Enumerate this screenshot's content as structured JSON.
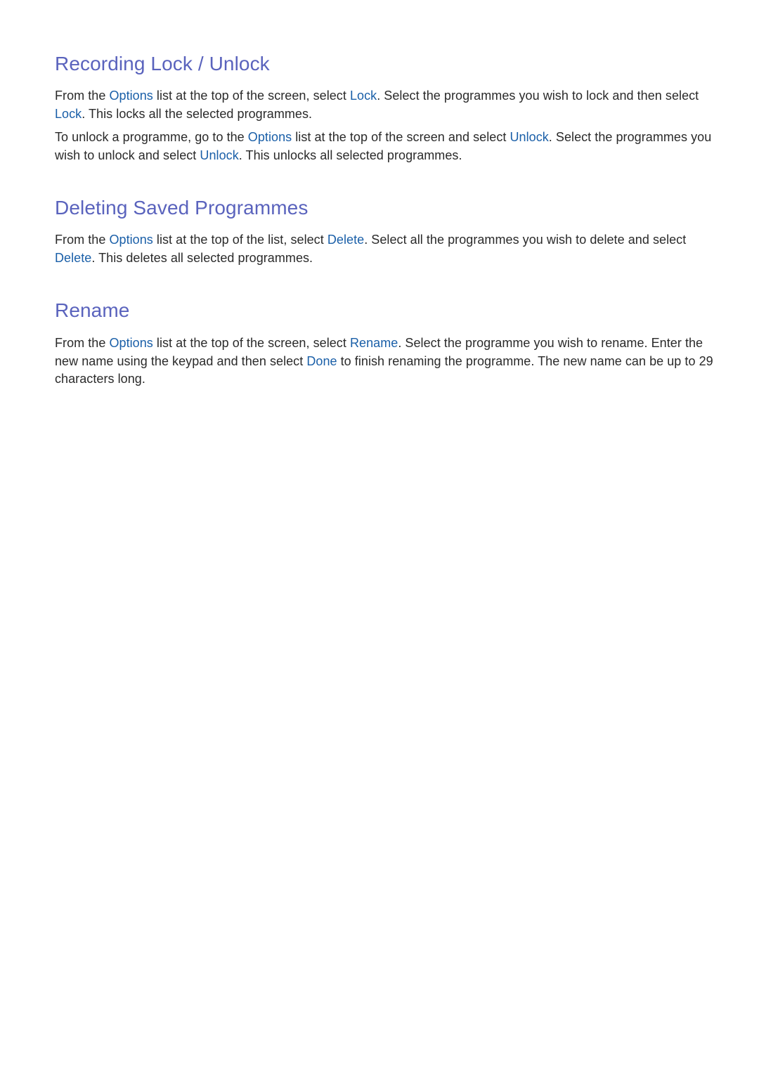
{
  "sections": [
    {
      "title": "Recording Lock / Unlock",
      "paragraphs": [
        {
          "segments": [
            {
              "text": "From the ",
              "kw": false
            },
            {
              "text": "Options",
              "kw": true
            },
            {
              "text": " list at the top of the screen, select ",
              "kw": false
            },
            {
              "text": "Lock",
              "kw": true
            },
            {
              "text": ". Select the programmes you wish to lock and then select ",
              "kw": false
            },
            {
              "text": "Lock",
              "kw": true
            },
            {
              "text": ". This locks all the selected programmes.",
              "kw": false
            }
          ]
        },
        {
          "segments": [
            {
              "text": "To unlock a programme, go to the ",
              "kw": false
            },
            {
              "text": "Options",
              "kw": true
            },
            {
              "text": " list at the top of the screen and select ",
              "kw": false
            },
            {
              "text": "Unlock",
              "kw": true
            },
            {
              "text": ". Select the programmes you wish to unlock and select ",
              "kw": false
            },
            {
              "text": "Unlock",
              "kw": true
            },
            {
              "text": ". This unlocks all selected programmes.",
              "kw": false
            }
          ]
        }
      ]
    },
    {
      "title": "Deleting Saved Programmes",
      "paragraphs": [
        {
          "segments": [
            {
              "text": "From the ",
              "kw": false
            },
            {
              "text": "Options",
              "kw": true
            },
            {
              "text": " list at the top of the list, select ",
              "kw": false
            },
            {
              "text": "Delete",
              "kw": true
            },
            {
              "text": ". Select all the programmes you wish to delete and select ",
              "kw": false
            },
            {
              "text": "Delete",
              "kw": true
            },
            {
              "text": ". This deletes all selected programmes.",
              "kw": false
            }
          ]
        }
      ]
    },
    {
      "title": "Rename",
      "paragraphs": [
        {
          "segments": [
            {
              "text": "From the ",
              "kw": false
            },
            {
              "text": "Options",
              "kw": true
            },
            {
              "text": " list at the top of the screen, select ",
              "kw": false
            },
            {
              "text": "Rename",
              "kw": true
            },
            {
              "text": ". Select the programme you wish to rename. Enter the new name using the keypad and then select ",
              "kw": false
            },
            {
              "text": "Done",
              "kw": true
            },
            {
              "text": " to finish renaming the programme. The new name can be up to 29 characters long.",
              "kw": false
            }
          ]
        }
      ]
    }
  ],
  "colors": {
    "heading": "#5a63bd",
    "keyword": "#1a5fa8",
    "body_text": "#2a2a2a",
    "background": "#ffffff"
  }
}
